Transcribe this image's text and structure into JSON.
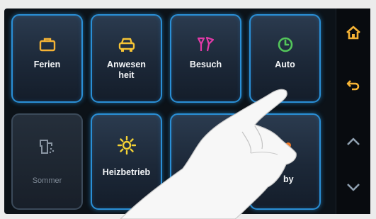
{
  "tiles": {
    "ferien": {
      "label": "Ferien",
      "icon": "suitcase-icon",
      "color": "#f5b335"
    },
    "anwesenheit": {
      "label": "Anwesen\nheit",
      "icon": "car-icon",
      "color": "#f5c335"
    },
    "besuch": {
      "label": "Besuch",
      "icon": "cocktail-glasses-icon",
      "color": "#e23aa8"
    },
    "auto": {
      "label": "Auto",
      "icon": "clock-icon",
      "color": "#53c65a"
    },
    "sommer": {
      "label": "Sommer",
      "icon": "tap-shower-icon",
      "color": "#7d8895"
    },
    "heizbetrieb": {
      "label": "Heizbetrieb",
      "icon": "sun-icon",
      "color": "#f5d335"
    },
    "tile7": {
      "label": "",
      "icon": "circle-icon",
      "color": "#2a8fd6"
    },
    "standby": {
      "label": "by",
      "icon": "power-icon",
      "color": "#f07a2a"
    }
  },
  "sidebar": {
    "home": {
      "icon": "home-icon",
      "color": "#f5b335"
    },
    "back": {
      "icon": "back-arrow-icon",
      "color": "#f5b335"
    },
    "up": {
      "icon": "chevron-up-icon",
      "color": "#8fa0b0"
    },
    "down": {
      "icon": "chevron-down-icon",
      "color": "#8fa0b0"
    }
  }
}
